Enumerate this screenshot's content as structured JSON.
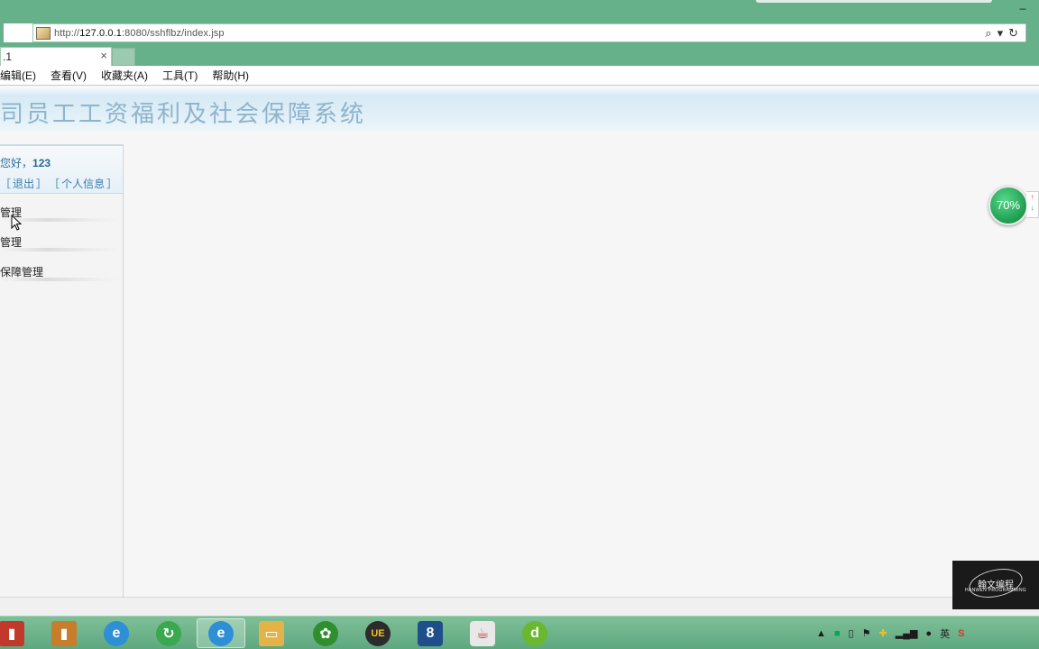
{
  "browser": {
    "address": {
      "url_prefix": "http://",
      "url_host": "127.0.0.1",
      "url_rest": ":8080/sshflbz/index.jsp"
    },
    "tab": {
      "title": ".1",
      "close": "×"
    },
    "menu": [
      "编辑(E)",
      "查看(V)",
      "收藏夹(A)",
      "工具(T)",
      "帮助(H)"
    ]
  },
  "page": {
    "system_title": "司员工工资福利及社会保障系统",
    "user": {
      "greeting": "您好，",
      "username": "123",
      "links": {
        "open1": "［",
        "logout": "退出",
        "close1": "］",
        "open2": "［",
        "profile": "个人信息",
        "close2": "］"
      }
    },
    "nav": [
      {
        "label": "管理"
      },
      {
        "label": "管理"
      },
      {
        "label": "保障管理"
      }
    ]
  },
  "widget": {
    "speed": "70%"
  },
  "watermark": {
    "cn": "翰文编程",
    "en": "HANWEN PROGRAMMING"
  },
  "taskbar": {
    "apps": [
      {
        "name": "notebook-app",
        "color": "#c0392b",
        "glyph": "▮"
      },
      {
        "name": "book-app",
        "color": "#c77d2a",
        "glyph": "▮"
      },
      {
        "name": "ie-app",
        "color": "#2d8fd6",
        "glyph": "e"
      },
      {
        "name": "browser-green-app",
        "color": "#3aa84f",
        "glyph": "↻"
      },
      {
        "name": "ie-active-app",
        "color": "#2d8fd6",
        "glyph": "e"
      },
      {
        "name": "folder-app",
        "color": "#e3b348",
        "glyph": "▭"
      },
      {
        "name": "paw-app",
        "color": "#2f8f2f",
        "glyph": "✿"
      },
      {
        "name": "ultraedit-app",
        "color": "#2c2c2c",
        "glyph": "UE"
      },
      {
        "name": "eight-app",
        "color": "#1f4f8a",
        "glyph": "8"
      },
      {
        "name": "java-app",
        "color": "#e8e8e8",
        "glyph": "☕"
      },
      {
        "name": "d-app",
        "color": "#6ab82e",
        "glyph": "d"
      }
    ],
    "tray": {
      "arrow": "▲",
      "ime": "英",
      "s": "S"
    }
  }
}
